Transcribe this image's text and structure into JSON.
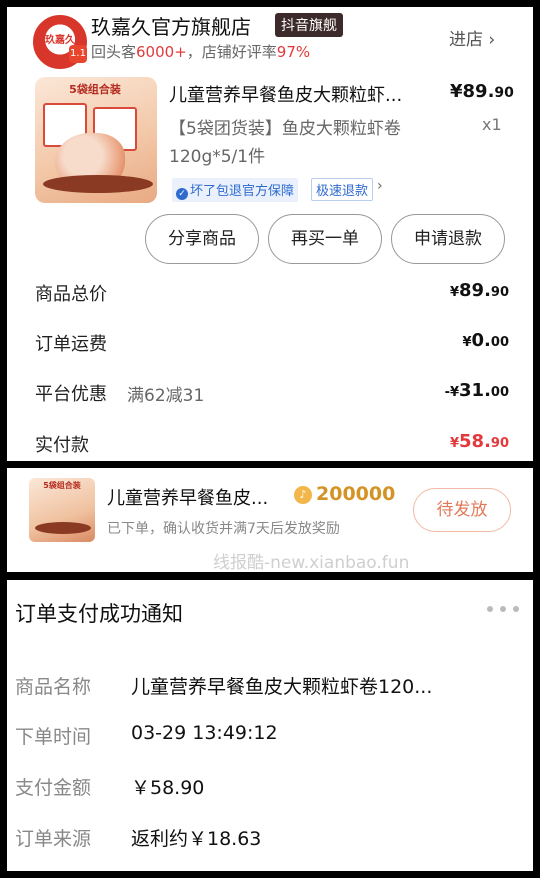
{
  "store": {
    "logo_text": "玖嘉久",
    "logo_badge": "1.1",
    "name": "玖嘉久官方旗舰店",
    "tag": "抖音旗舰",
    "sub_prefix": "回头客",
    "repeat_customers": "6000+",
    "sub_middle": "，店铺好评率",
    "good_rate": "97%",
    "enter_label": "进店 ›"
  },
  "product": {
    "image_label": "5袋组合装",
    "title": "儿童营养早餐鱼皮大颗粒虾...",
    "price_int": "¥89.",
    "price_dec": "90",
    "spec": "【5袋团货装】鱼皮大颗粒虾卷120g*5/1件",
    "qty": "x1",
    "guarantee_icon": "✓",
    "guarantee": "坏了包退官方保障",
    "refund_tag": "极速退款",
    "arrow": "›"
  },
  "actions": {
    "share": "分享商品",
    "rebuy": "再买一单",
    "refund": "申请退款"
  },
  "summary": {
    "total_label": "商品总价",
    "total_cur": "¥",
    "total_int": "89.",
    "total_dec": "90",
    "shipping_label": "订单运费",
    "shipping_cur": "¥",
    "shipping_int": "0.",
    "shipping_dec": "00",
    "discount_label": "平台优惠",
    "discount_note": "满62减31",
    "discount_cur": "-¥",
    "discount_int": "31.",
    "discount_dec": "00",
    "paid_label": "实付款",
    "paid_cur": "¥",
    "paid_int": "58.",
    "paid_dec": "90"
  },
  "rebate": {
    "image_label": "5袋组合装",
    "title": "儿童营养早餐鱼皮...",
    "coin_icon": "♪",
    "coins": "200000",
    "sub": "已下单，确认收货并满7天后发放奖励",
    "status": "待发放",
    "watermark": "线报酷-new.xianbao.fun"
  },
  "notice": {
    "title": "订单支付成功通知",
    "rows": [
      {
        "key": "商品名称",
        "value": "儿童营养早餐鱼皮大颗粒虾卷120..."
      },
      {
        "key": "下单时间",
        "value": "03-29 13:49:12"
      },
      {
        "key": "支付金额",
        "value": "￥58.90"
      },
      {
        "key": "订单来源",
        "value": "返利约￥18.63"
      }
    ]
  },
  "colors": {
    "accent_red": "#e4393c",
    "coin_gold": "#d39325",
    "guarantee_blue": "#2f6bcf"
  }
}
